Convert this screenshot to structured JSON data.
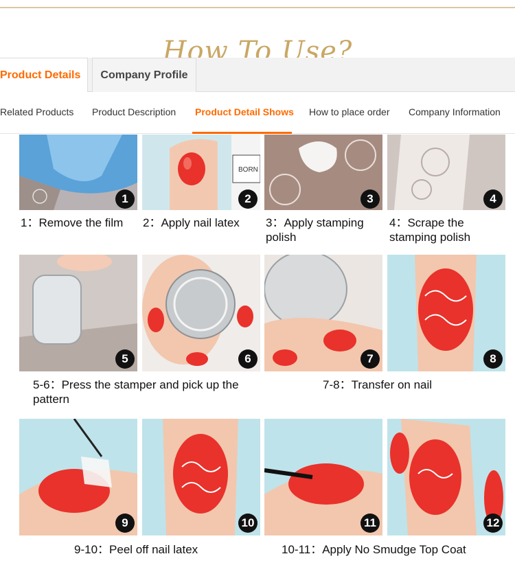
{
  "header": {
    "title": "How To Use?"
  },
  "tabs": [
    {
      "label": "Product Details",
      "active": true
    },
    {
      "label": "Company Profile",
      "active": false
    }
  ],
  "subnav": [
    {
      "label": "Related Products",
      "active": false
    },
    {
      "label": "Product Description",
      "active": false
    },
    {
      "label": "Product Detail Shows",
      "active": true
    },
    {
      "label": "How to place order",
      "active": false
    },
    {
      "label": "Company Information",
      "active": false
    }
  ],
  "steps": {
    "numbers": [
      "1",
      "2",
      "3",
      "4",
      "5",
      "6",
      "7",
      "8",
      "9",
      "10",
      "11",
      "12"
    ],
    "captions": [
      "1：Remove the film",
      "2：Apply nail latex",
      "3：Apply stamping polish",
      "4：Scrape the stamping polish",
      "5-6：Press the stamper and pick up the pattern",
      "7-8：Transfer on nail",
      "9-10：Peel off nail latex",
      "10-11：Apply No Smudge Top Coat"
    ],
    "bottle_label": "BORN"
  },
  "colors": {
    "accent": "#ff6a00",
    "title_gold": "#c9a765",
    "nail_red": "#e8322b"
  }
}
